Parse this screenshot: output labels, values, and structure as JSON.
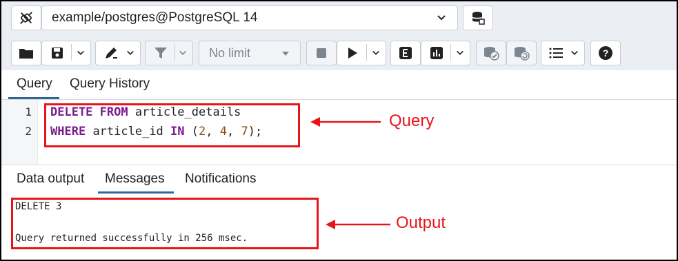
{
  "connection": {
    "label": "example/postgres@PostgreSQL 14",
    "icon": "plug-icon"
  },
  "toolbar": {
    "limit_label": "No limit",
    "buttons": [
      "open-file-icon",
      "save-icon",
      "edit-icon",
      "filter-icon",
      "stop-icon",
      "execute-icon",
      "explain-icon",
      "explain-analyze-icon",
      "commit-icon",
      "rollback-icon",
      "macros-icon",
      "help-icon"
    ]
  },
  "editor_tabs": [
    {
      "label": "Query",
      "active": true
    },
    {
      "label": "Query History",
      "active": false
    }
  ],
  "editor": {
    "lines": [
      {
        "number": "1",
        "kw1": "DELETE",
        "kw2": "FROM",
        "rest": "article_details"
      },
      {
        "number": "2",
        "kw1": "WHERE",
        "ident": "article_id",
        "kw2": "IN",
        "open": "(",
        "n1": "2",
        "n2": "4",
        "n3": "7",
        "close": ");"
      }
    ]
  },
  "output_tabs": [
    {
      "label": "Data output",
      "active": false
    },
    {
      "label": "Messages",
      "active": true
    },
    {
      "label": "Notifications",
      "active": false
    }
  ],
  "messages": {
    "line1": "DELETE 3",
    "line2": "Query returned successfully in 256 msec."
  },
  "annotations": {
    "query": "Query",
    "output": "Output",
    "color": "#e8141a"
  },
  "colors": {
    "accent": "#326690",
    "keyword": "#7a1d8c",
    "number": "#8a4b14"
  }
}
